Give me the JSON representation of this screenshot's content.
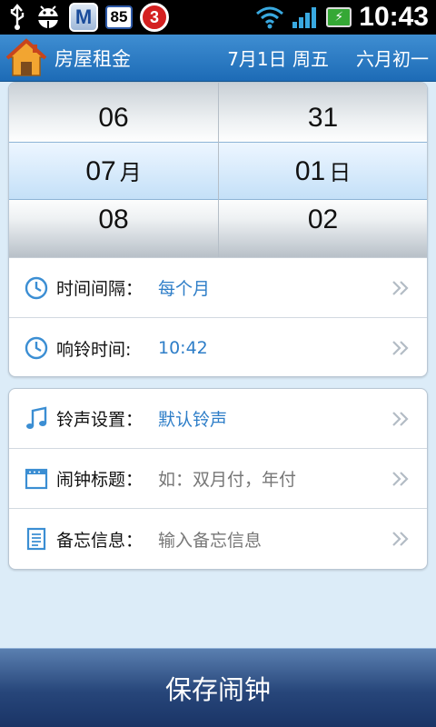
{
  "status_bar": {
    "usb_icon": "usb-icon",
    "android_icon": "android-debug-icon",
    "shield_letter": "M",
    "badge_count": "85",
    "alarm_count": "3",
    "time": "10:43"
  },
  "header": {
    "title": "房屋租金",
    "date": "7月1日 周五",
    "lunar": "六月初一",
    "home_icon": "home-icon"
  },
  "picker": {
    "month": {
      "prev": "06",
      "current": "07",
      "next": "08",
      "unit": "月"
    },
    "day": {
      "prev": "31",
      "current": "01",
      "next": "02",
      "unit": "日"
    }
  },
  "settings_group1": [
    {
      "icon": "clock-icon",
      "label": "时间间隔：",
      "value": "每个月"
    },
    {
      "icon": "clock-icon",
      "label": "响铃时间:",
      "value": "10:42"
    }
  ],
  "settings_group2": [
    {
      "icon": "music-note-icon",
      "label": "铃声设置：",
      "value": "默认铃声"
    },
    {
      "icon": "title-card-icon",
      "label": "闹钟标题：",
      "placeholder": "如：双月付，年付"
    },
    {
      "icon": "memo-icon",
      "label": "备忘信息：",
      "placeholder": "输入备忘信息"
    }
  ],
  "actions": {
    "save_label": "保存闹钟"
  },
  "colors": {
    "accent": "#2e7ec8",
    "header": "#1d6bb6",
    "button": "#27467a"
  }
}
